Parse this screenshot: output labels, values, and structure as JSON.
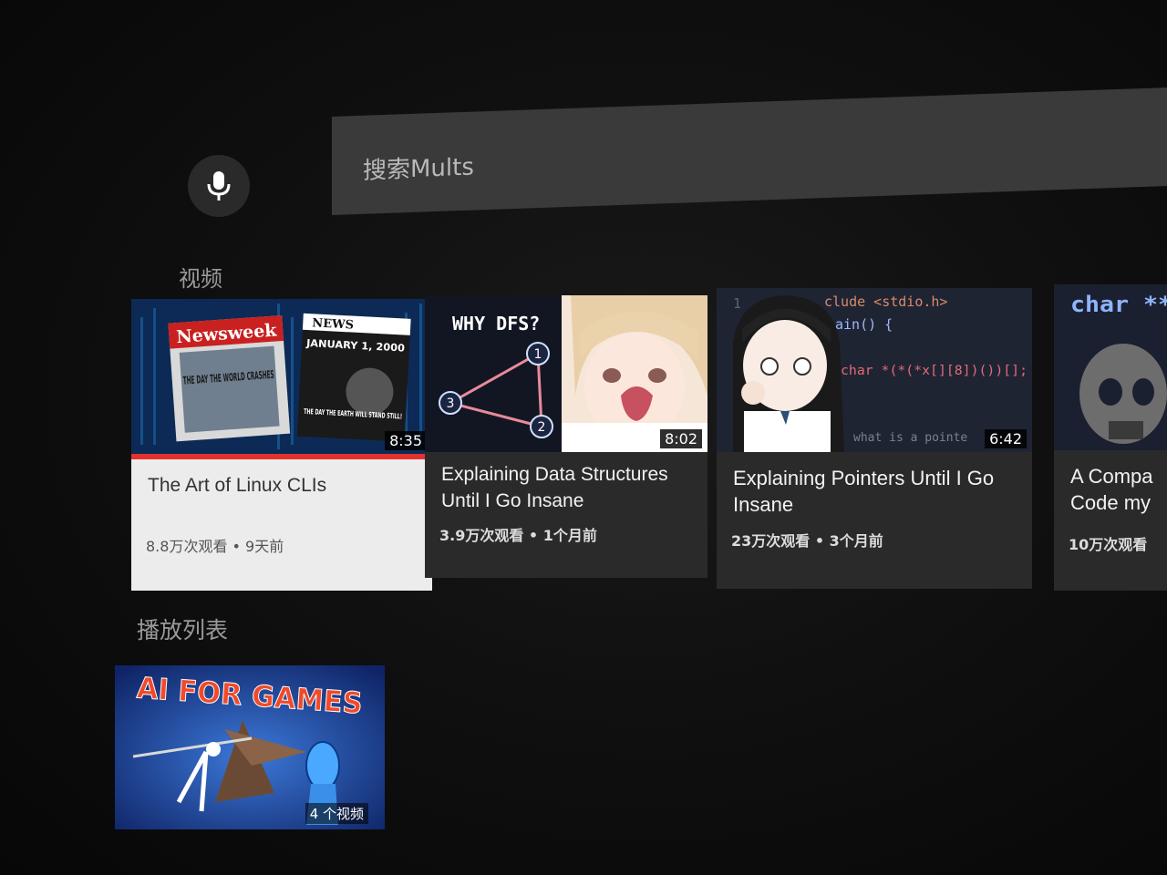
{
  "search": {
    "placeholder": "搜索Mults"
  },
  "sections": {
    "videos_title": "视频",
    "playlists_title": "播放列表"
  },
  "videos": [
    {
      "title": "The Art of Linux CLIs",
      "meta": "8.8万次观看 • 9天前",
      "duration": "8:35",
      "thumb": {
        "magazine1": "Newsweek",
        "headline1": "THE DAY THE WORLD CRASHES",
        "magazine2": "NEWS",
        "headline2a": "JANUARY 1, 2000",
        "headline2b": "THE DAY THE EARTH WILL STAND STILL!"
      }
    },
    {
      "title": "Explaining Data Structures Until I Go Insane",
      "meta": "3.9万次观看 • 1个月前",
      "duration": "8:02",
      "thumb": {
        "caption": "WHY DFS?",
        "nodes": [
          "1",
          "2",
          "3"
        ]
      }
    },
    {
      "title": "Explaining Pointers Until I Go Insane",
      "meta": "23万次观看 • 3个月前",
      "duration": "6:42",
      "thumb": {
        "line0": "1",
        "line1": "clude <stdio.h>",
        "line2": "ain() {",
        "line3": "char *(*(*x[][8])())[];",
        "line4": "}",
        "line5": "what is a pointe"
      }
    },
    {
      "title": "A Compa Code my",
      "meta": "10万次观看",
      "duration": "",
      "thumb": {
        "code": "char **"
      }
    }
  ],
  "playlists": [
    {
      "title": "AI FOR GAMES",
      "count": "4 个视频"
    }
  ],
  "colors": {
    "accent": "#e5322c",
    "focused_card": "#ececec",
    "card": "#2a2a2a",
    "search_bar": "#3a3a3a"
  }
}
